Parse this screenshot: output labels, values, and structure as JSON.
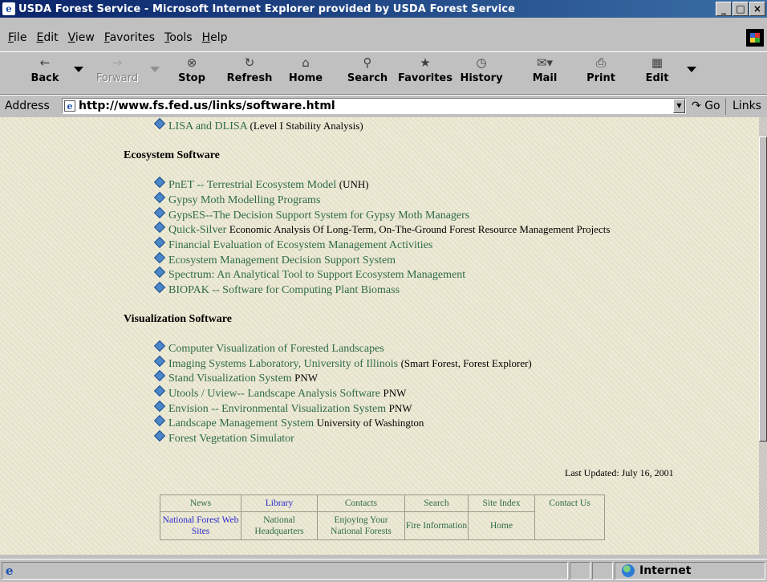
{
  "window": {
    "title": "USDA Forest Service - Microsoft Internet Explorer provided by USDA Forest Service",
    "app_icon": "ie-icon",
    "controls": {
      "minimize": "_",
      "maximize": "□",
      "close": "×"
    }
  },
  "menu": [
    "File",
    "Edit",
    "View",
    "Favorites",
    "Tools",
    "Help"
  ],
  "toolbar": {
    "back": "Back",
    "forward": "Forward",
    "stop": "Stop",
    "refresh": "Refresh",
    "home": "Home",
    "search": "Search",
    "favorites": "Favorites",
    "history": "History",
    "mail": "Mail",
    "print": "Print",
    "edit": "Edit"
  },
  "address": {
    "label": "Address",
    "url": "http://www.fs.fed.us/links/software.html",
    "go": "Go",
    "links": "Links"
  },
  "content": {
    "top_item": {
      "link": "LISA and DLISA",
      "note": "(Level I Stability Analysis)"
    },
    "sections": [
      {
        "heading": "Ecosystem Software",
        "items": [
          {
            "link": "PnET -- Terrestrial Ecosystem Model",
            "note": "(UNH)"
          },
          {
            "link": "Gypsy Moth Modelling Programs",
            "note": ""
          },
          {
            "link": "GypsES--The Decision Support System for Gypsy Moth Managers",
            "note": ""
          },
          {
            "link": "Quick-Silver",
            "note": "Economic Analysis Of Long-Term, On-The-Ground Forest Resource Management Projects"
          },
          {
            "link": "Financial Evaluation of Ecosystem Management Activities",
            "note": ""
          },
          {
            "link": "Ecosystem Management Decision Support System",
            "note": ""
          },
          {
            "link": "Spectrum: An Analytical Tool to Support Ecosystem Management",
            "note": ""
          },
          {
            "link": "BIOPAK -- Software for Computing Plant Biomass",
            "note": ""
          }
        ]
      },
      {
        "heading": "Visualization Software",
        "items": [
          {
            "link": "Computer Visualization of Forested Landscapes",
            "note": ""
          },
          {
            "link": "Imaging Systems Laboratory, University of Illinois",
            "note": "(Smart Forest, Forest Explorer)"
          },
          {
            "link": "Stand Visualization System",
            "note": "PNW"
          },
          {
            "link": "Utools / Uview-- Landscape Analysis Software",
            "note": "PNW"
          },
          {
            "link": "Envision -- Environmental Visualization System",
            "note": "PNW"
          },
          {
            "link": "Landscape Management System",
            "note": "University of Washington"
          },
          {
            "link": "Forest Vegetation Simulator",
            "note": ""
          }
        ]
      }
    ],
    "last_updated": "Last Updated: July 16, 2001"
  },
  "footer_nav": {
    "row1": [
      "News",
      "Library",
      "Contacts",
      "Search",
      "Site Index"
    ],
    "row2": [
      "National Forest Web Sites",
      "National Headquarters",
      "Enjoying Your National Forests",
      "Fire Information",
      "Home"
    ],
    "contact": "Contact Us"
  },
  "status": {
    "zone": "Internet"
  },
  "colors": {
    "link": "#2f6b4a",
    "visited_link": "#2a2ad0",
    "title_bar": "#0a246a",
    "page_bg": "#ebe8d2"
  }
}
